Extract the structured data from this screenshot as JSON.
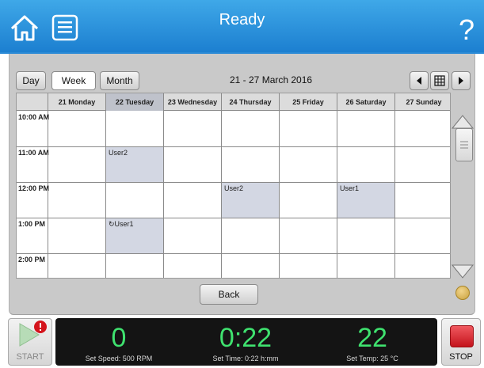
{
  "header": {
    "title": "Ready",
    "help": "?"
  },
  "toolbar": {
    "day": "Day",
    "week": "Week",
    "month": "Month",
    "range": "21 - 27 March 2016"
  },
  "days": [
    "21 Monday",
    "22 Tuesday",
    "23 Wednesday",
    "24 Thursday",
    "25 Friday",
    "26 Saturday",
    "27 Sunday"
  ],
  "selected_day_index": 1,
  "times": [
    "10:00 AM",
    "11:00 AM",
    "12:00 PM",
    "1:00 PM",
    "2:00 PM"
  ],
  "events": [
    {
      "label": "User2",
      "day": 1,
      "hour": 1
    },
    {
      "label": "User2",
      "day": 3,
      "hour": 2
    },
    {
      "label": "User1",
      "day": 5,
      "hour": 2
    },
    {
      "label": "↻User1",
      "day": 1,
      "hour": 3
    }
  ],
  "back_label": "Back",
  "footer": {
    "start_label": "START",
    "stop_label": "STOP",
    "speed": {
      "value": "0",
      "label": "Set Speed: 500 RPM"
    },
    "time": {
      "value": "0:22",
      "label": "Set Time: 0:22 h:mm"
    },
    "temp": {
      "value": "22",
      "label": "Set Temp: 25 °C"
    }
  },
  "colors": {
    "header": "#1c7fd0",
    "accent_green": "#3fe26f",
    "event_fill": "#d3d7e3",
    "stop_red": "#c4141c"
  }
}
